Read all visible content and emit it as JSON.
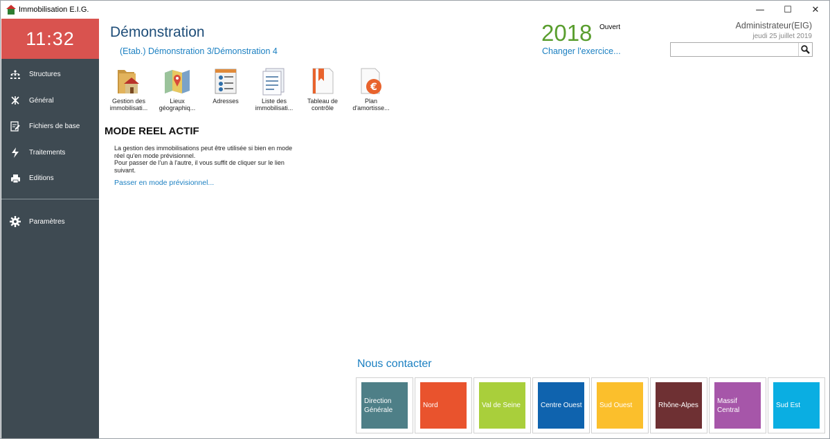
{
  "window": {
    "title": "Immobilisation E.I.G.",
    "controls": {
      "minimize": "—",
      "maximize": "☐",
      "close": "✕"
    }
  },
  "sidebar": {
    "clock": "11:32",
    "items": [
      {
        "label": "Structures",
        "icon": "hierarchy-icon"
      },
      {
        "label": "Général",
        "icon": "tools-icon"
      },
      {
        "label": "Fichiers de base",
        "icon": "edit-file-icon"
      },
      {
        "label": "Traitements",
        "icon": "bolt-icon"
      },
      {
        "label": "Editions",
        "icon": "printer-icon"
      }
    ],
    "settings": {
      "label": "Paramètres",
      "icon": "gear-icon"
    }
  },
  "header": {
    "company": "Démonstration",
    "etab": "(Etab.) Démonstration 3/Démonstration 4",
    "year": "2018",
    "status": "Ouvert",
    "change_exercise": "Changer l'exercice...",
    "user": "Administrateur(EIG)",
    "date": "jeudi 25 juillet 2019",
    "search": {
      "value": "",
      "placeholder": ""
    }
  },
  "toolbar": [
    {
      "label": "Gestion des immobilisati...",
      "icon": "house-folder-icon"
    },
    {
      "label": "Lieux géographiq...",
      "icon": "map-icon"
    },
    {
      "label": "Adresses",
      "icon": "address-book-icon"
    },
    {
      "label": "Liste des immobilisati...",
      "icon": "list-document-icon"
    },
    {
      "label": "Tableau de contrôle",
      "icon": "bookmark-document-icon"
    },
    {
      "label": "Plan d'amortisse...",
      "icon": "euro-document-icon"
    }
  ],
  "mode": {
    "title": "MODE REEL ACTIF",
    "text": "La gestion des immobilisations peut être utilisée si bien en mode réel qu'en mode prévisionnel.\nPour passer de l'un à l'autre, il vous suffit de cliquer sur le lien suivant.",
    "link": "Passer en mode prévisionnel..."
  },
  "contact": {
    "title": "Nous contacter",
    "tiles": [
      {
        "label": "Direction Générale",
        "color": "#4e7f87"
      },
      {
        "label": "Nord",
        "color": "#e9532d"
      },
      {
        "label": "Val de Seine",
        "color": "#a9cf3b"
      },
      {
        "label": "Centre Ouest",
        "color": "#0f63ae"
      },
      {
        "label": "Sud Ouest",
        "color": "#fbbf2c"
      },
      {
        "label": "Rhône-Alpes",
        "color": "#6e3033"
      },
      {
        "label": "Massif Central",
        "color": "#a656a9"
      },
      {
        "label": "Sud Est",
        "color": "#0aaee2"
      }
    ]
  }
}
